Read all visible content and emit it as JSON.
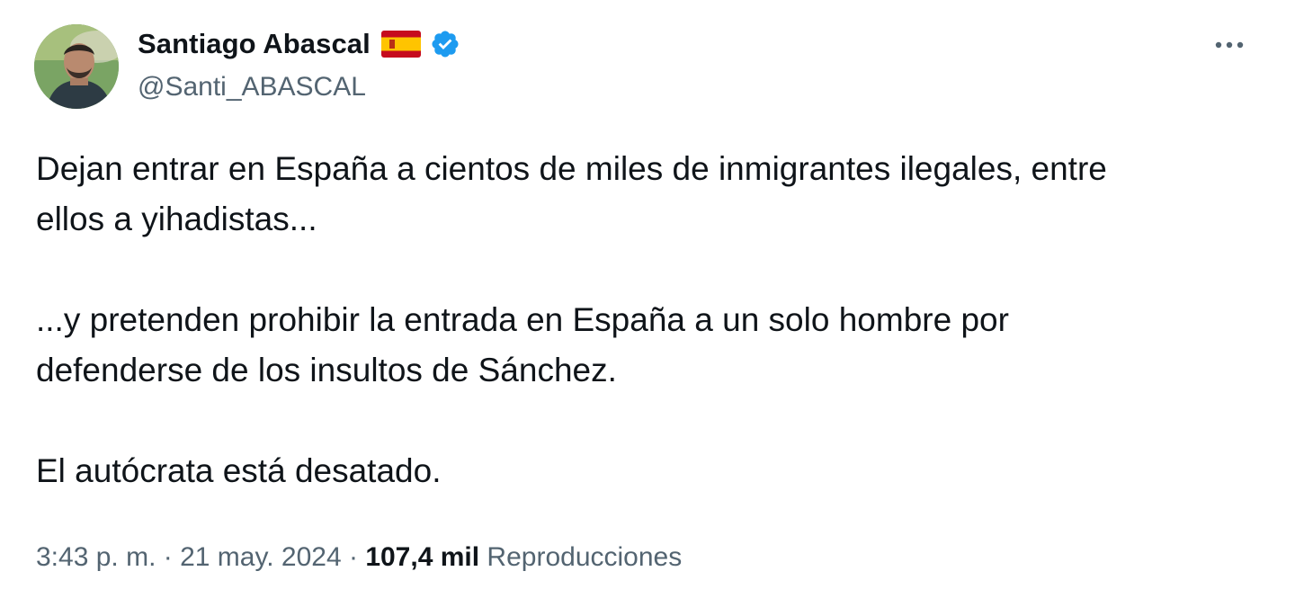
{
  "author": {
    "display_name": "Santiago Abascal",
    "handle": "@Santi_ABASCAL",
    "flag_icon": "spain-flag-icon",
    "verified_icon": "verified-badge-icon",
    "verified_color": "#1d9bf0"
  },
  "tweet": {
    "lines": [
      "Dejan entrar en España a cientos de miles de inmigrantes ilegales, entre",
      "ellos  a yihadistas...",
      "...y  pretenden prohibir la entrada en España a un solo hombre por",
      "defenderse de los insultos de Sánchez.",
      "El autócrata está desatado."
    ]
  },
  "meta": {
    "time": "3:43 p. m.",
    "separator": " · ",
    "date": "21 may. 2024",
    "views_count": "107,4 mil",
    "views_label": "Reproducciones"
  },
  "colors": {
    "text_primary": "#0f1419",
    "text_secondary": "#536471",
    "verified": "#1d9bf0"
  }
}
